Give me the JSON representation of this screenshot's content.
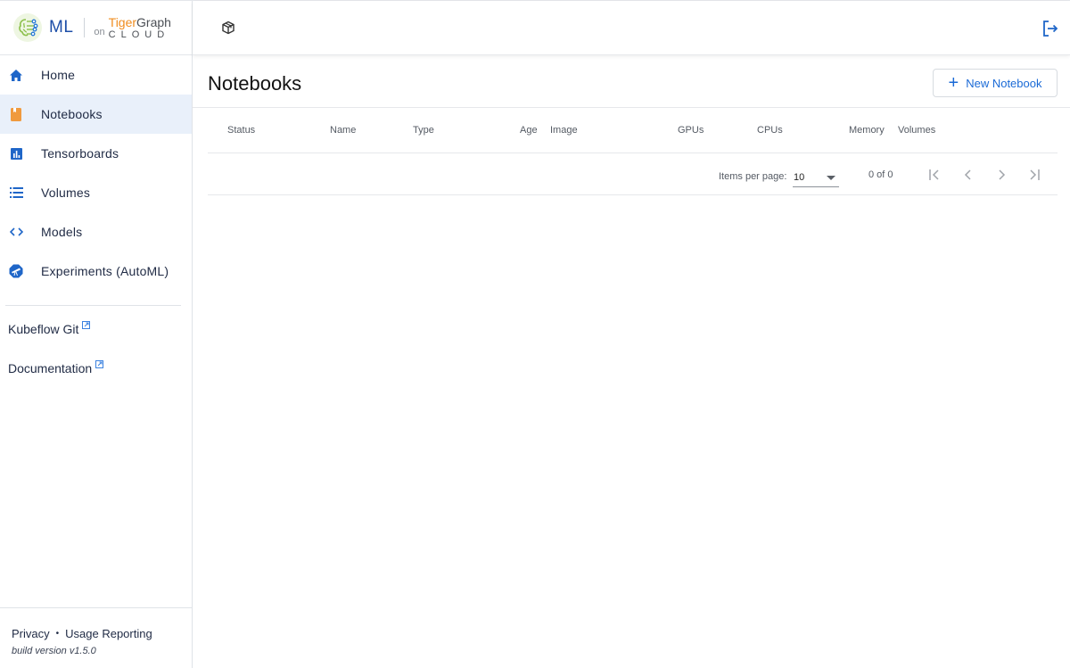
{
  "brand": {
    "product": "ML",
    "on": "on",
    "partner_top_a": "Tiger",
    "partner_top_b": "Graph",
    "partner_bottom": "CLOUD",
    "colors": {
      "ml_blue": "#1d4ea8",
      "tiger_orange": "#f08c1e",
      "logo_green": "#8cc04b"
    }
  },
  "sidebar": {
    "items": [
      {
        "label": "Home",
        "icon": "home-icon",
        "active": false
      },
      {
        "label": "Notebooks",
        "icon": "notebook-icon",
        "active": true
      },
      {
        "label": "Tensorboards",
        "icon": "bar-chart-icon",
        "active": false
      },
      {
        "label": "Volumes",
        "icon": "list-icon",
        "active": false
      },
      {
        "label": "Models",
        "icon": "code-icon",
        "active": false
      },
      {
        "label": "Experiments (AutoML)",
        "icon": "telescope-icon",
        "active": false
      }
    ],
    "external_links": [
      {
        "label": "Kubeflow Git",
        "icon": "external-link-icon"
      },
      {
        "label": "Documentation",
        "icon": "external-link-icon"
      }
    ],
    "footer": {
      "privacy": "Privacy",
      "separator": "•",
      "usage": "Usage Reporting",
      "build": "build version v1.5.0"
    }
  },
  "topbar": {
    "namespace_icon": "cube-icon",
    "logout_icon": "logout-icon"
  },
  "page": {
    "title": "Notebooks",
    "new_button": "New Notebook",
    "accent": "#1a6ad6"
  },
  "table": {
    "columns": [
      "Status",
      "Name",
      "Type",
      "Age",
      "Image",
      "GPUs",
      "CPUs",
      "Memory",
      "Volumes"
    ],
    "rows": []
  },
  "paginator": {
    "items_per_page_label": "Items per page:",
    "items_per_page": "10",
    "range": "0 of 0"
  }
}
